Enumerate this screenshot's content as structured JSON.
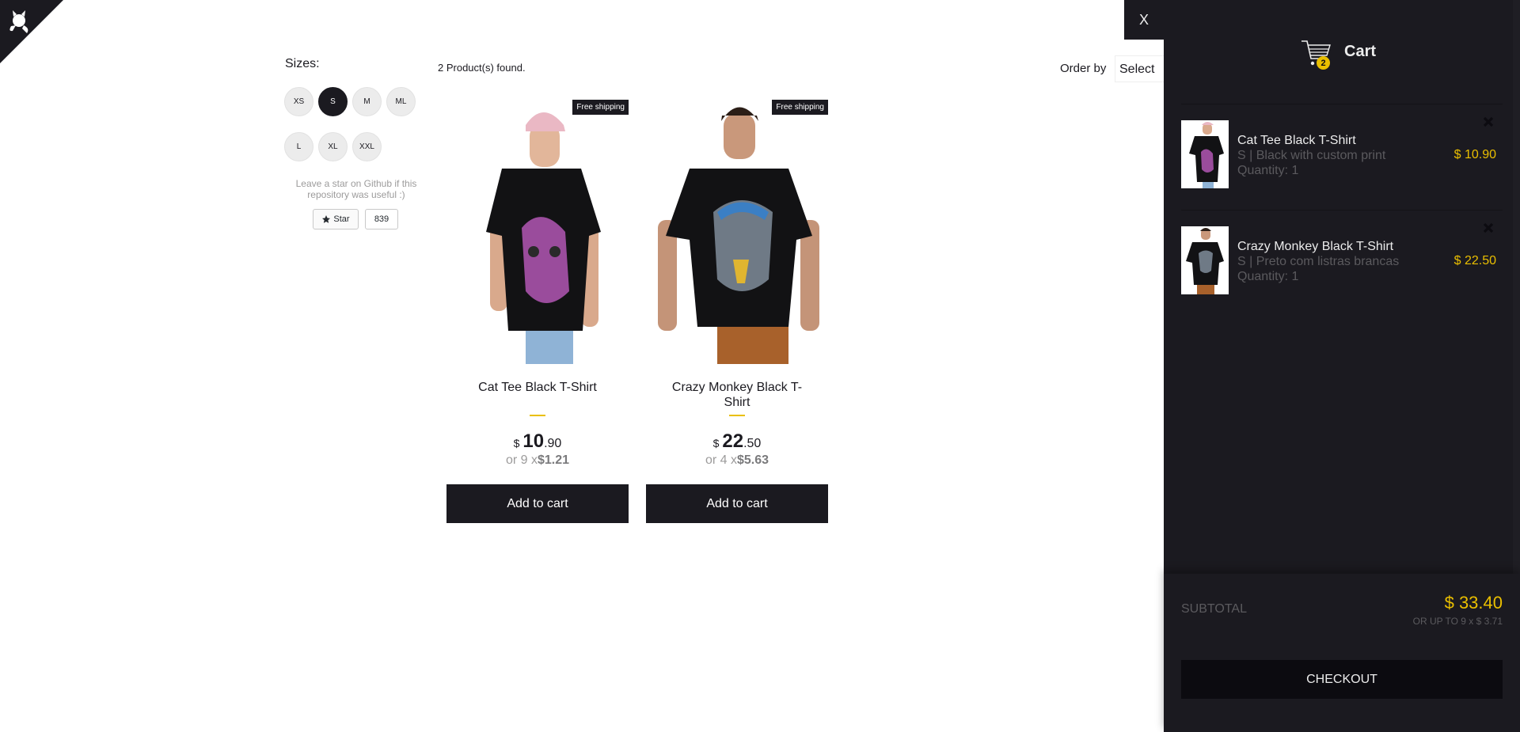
{
  "filters": {
    "title": "Sizes:",
    "sizes": [
      "XS",
      "S",
      "M",
      "ML",
      "L",
      "XL",
      "XXL"
    ],
    "active_size": "S"
  },
  "github": {
    "note": "Leave a star on Github if this repository was useful :)",
    "star_label": "Star",
    "star_count": "839"
  },
  "shelf": {
    "found_text": "2 Product(s) found.",
    "order_by_label": "Order by",
    "order_by_value": "Select",
    "products": [
      {
        "title": "Cat Tee Black T-Shirt",
        "free_shipping": "Free shipping",
        "currency": "$",
        "price_int": "10",
        "price_cents": ".90",
        "install_prefix": "or 9 x",
        "install_value": "$1.21",
        "button": "Add to cart"
      },
      {
        "title": "Crazy Monkey Black T-Shirt",
        "free_shipping": "Free shipping",
        "currency": "$",
        "price_int": "22",
        "price_cents": ".50",
        "install_prefix": "or 4 x",
        "install_value": "$5.63",
        "button": "Add to cart"
      }
    ]
  },
  "cart": {
    "close_label": "X",
    "title": "Cart",
    "count": "2",
    "items": [
      {
        "name": "Cat Tee Black T-Shirt",
        "desc": "S | Black with custom print",
        "qty": "Quantity: 1",
        "price": "$ 10.90"
      },
      {
        "name": "Crazy Monkey Black T-Shirt",
        "desc": "S | Preto com listras brancas",
        "qty": "Quantity: 1",
        "price": "$ 22.50"
      }
    ],
    "subtotal_label": "SUBTOTAL",
    "subtotal_value": "$ 33.40",
    "subtotal_install": "OR UP TO 9 x $ 3.71",
    "checkout_label": "CHECKOUT"
  },
  "colors": {
    "dark": "#1b1a20",
    "accent": "#eabf00",
    "muted": "#5b5a5e"
  }
}
